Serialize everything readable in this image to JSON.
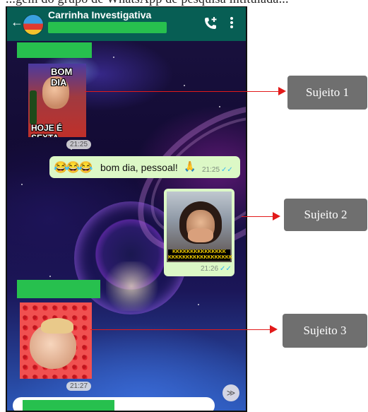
{
  "caption_fragment": "...gem do grupo de WhatsApp de pesquisa intitulada...",
  "app": {
    "back_icon": "arrow-left-icon",
    "group_name": "Carrinha Investigativa",
    "call_icon": "add-call-icon",
    "menu_icon": "more-vert-icon"
  },
  "messages": [
    {
      "type": "sticker",
      "direction": "incoming",
      "top_text": "BOM DIA",
      "bottom_text": "HOJE É SEXTA",
      "time": "21:25"
    },
    {
      "type": "text",
      "direction": "outgoing",
      "emojis": "😂😂😂",
      "text": "bom dia, pessoal!",
      "emoji_after": "🙏",
      "time": "21:25",
      "status": "read"
    },
    {
      "type": "sticker",
      "direction": "outgoing",
      "caption": "KKKKKKKKKKKKKKK KKKKKKKKKKKKKKKKKK",
      "time": "21:26",
      "status": "read"
    },
    {
      "type": "sticker",
      "direction": "incoming",
      "time": "21:27"
    }
  ],
  "callouts": [
    "Sujeito 1",
    "Sujeito 2",
    "Sujeito 3"
  ],
  "scroll_icon": "double-chevron-down-icon",
  "colors": {
    "appbar": "#075e54",
    "outgoing_bubble": "#dcf8c6",
    "redaction": "#27c04e",
    "callout_box": "#6f6f6f",
    "arrow": "#e21a1a",
    "read_ticks": "#34b7f1"
  }
}
